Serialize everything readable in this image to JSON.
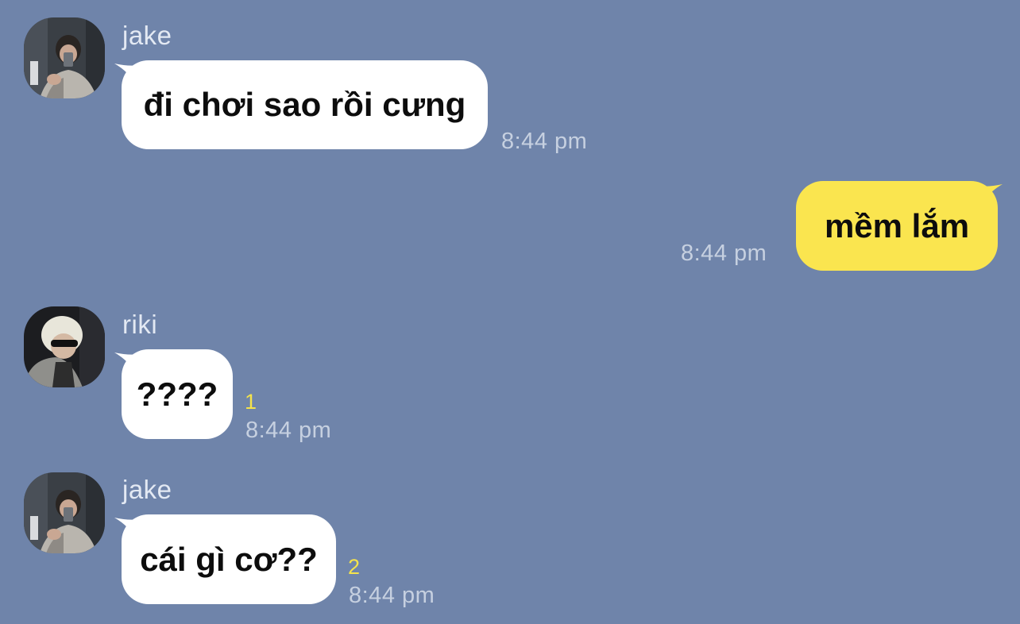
{
  "chat": {
    "messages": [
      {
        "sender": "jake",
        "avatar_icon": "jake-avatar",
        "text": "đi chơi sao rồi cưng",
        "time": "8:44 pm",
        "unread": ""
      },
      {
        "sender": "",
        "text": "mềm lắm",
        "time": "8:44 pm",
        "unread": ""
      },
      {
        "sender": "riki",
        "avatar_icon": "riki-avatar",
        "text": "????",
        "time": "8:44 pm",
        "unread": "1"
      },
      {
        "sender": "jake",
        "avatar_icon": "jake-avatar",
        "text": "cái gì cơ??",
        "time": "8:44 pm",
        "unread": "2"
      }
    ]
  },
  "colors": {
    "background": "#6f84aa",
    "incoming_bubble": "#ffffff",
    "outgoing_bubble": "#fae54f",
    "timestamp": "#c6d0e0",
    "unread_count": "#f5e34b"
  }
}
